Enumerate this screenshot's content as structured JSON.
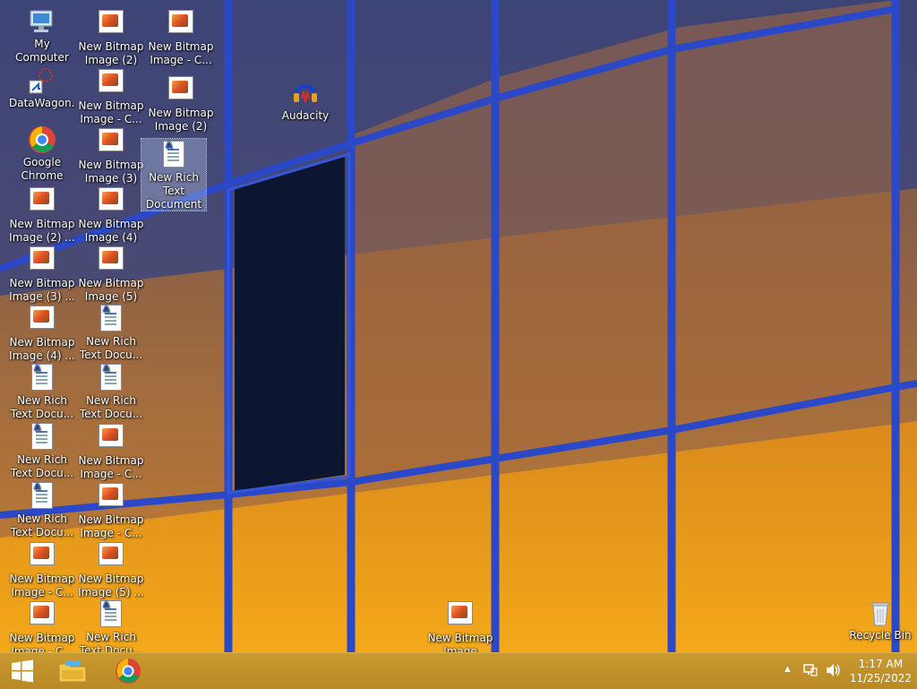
{
  "desktop": {
    "icons": [
      {
        "label": "My\nComputer",
        "type": "computer"
      },
      {
        "label": "DataWagon...",
        "type": "app"
      },
      {
        "label": "Google\nChrome",
        "type": "chrome"
      },
      {
        "label": "New Bitmap\nImage (2) ...",
        "type": "bitmap"
      },
      {
        "label": "New Bitmap\nImage (3) ...",
        "type": "bitmap"
      },
      {
        "label": "New Bitmap\nImage (4) ...",
        "type": "bitmap"
      },
      {
        "label": "New Rich\nText Docu...",
        "type": "rtf"
      },
      {
        "label": "New Rich\nText Docu...",
        "type": "rtf"
      },
      {
        "label": "New Rich\nText Docu...",
        "type": "rtf"
      },
      {
        "label": "New Bitmap\nImage - C...",
        "type": "bitmap"
      },
      {
        "label": "New Bitmap\nImage - C...",
        "type": "bitmap"
      },
      {
        "label": "New Bitmap\nImage (2) -...",
        "type": "bitmap"
      },
      {
        "label": "New Bitmap\nImage - C...",
        "type": "bitmap"
      },
      {
        "label": "New Bitmap\nImage (3) -...",
        "type": "bitmap"
      },
      {
        "label": "New Bitmap\nImage (4) -...",
        "type": "bitmap"
      },
      {
        "label": "New Bitmap\nImage (5) -...",
        "type": "bitmap"
      },
      {
        "label": "New Rich\nText Docu...",
        "type": "rtf"
      },
      {
        "label": "New Rich\nText Docu...",
        "type": "rtf"
      },
      {
        "label": "New Bitmap\nImage - C...",
        "type": "bitmap"
      },
      {
        "label": "New Bitmap\nImage - C...",
        "type": "bitmap"
      },
      {
        "label": "New Bitmap\nImage (5) ...",
        "type": "bitmap"
      },
      {
        "label": "New Rich\nText Docu...",
        "type": "rtf"
      },
      {
        "label": "New Bitmap\nImage - C...",
        "type": "bitmap"
      },
      {
        "label": "New Bitmap\nImage (2)",
        "type": "bitmap"
      },
      {
        "label": "New Rich\nText\nDocument",
        "type": "rtf",
        "selected": true
      },
      {
        "label": "Audacity",
        "type": "audacity"
      },
      {
        "label": "New Bitmap\nImage",
        "type": "bitmap"
      },
      {
        "label": "Recycle Bin",
        "type": "recycle"
      }
    ]
  },
  "taskbar": {
    "clock_time": "1:17 AM",
    "clock_date": "11/25/2022",
    "tray_chevron": "▲",
    "pinned": [
      {
        "name": "start-button-icon"
      },
      {
        "name": "file-explorer-icon"
      },
      {
        "name": "chrome-icon"
      }
    ]
  },
  "colors": {
    "taskbar": "#c08f2a",
    "wall_frame": "#2a48c8",
    "glass_top": "#4a4f7a",
    "glass_bottom": "#f0a020"
  }
}
